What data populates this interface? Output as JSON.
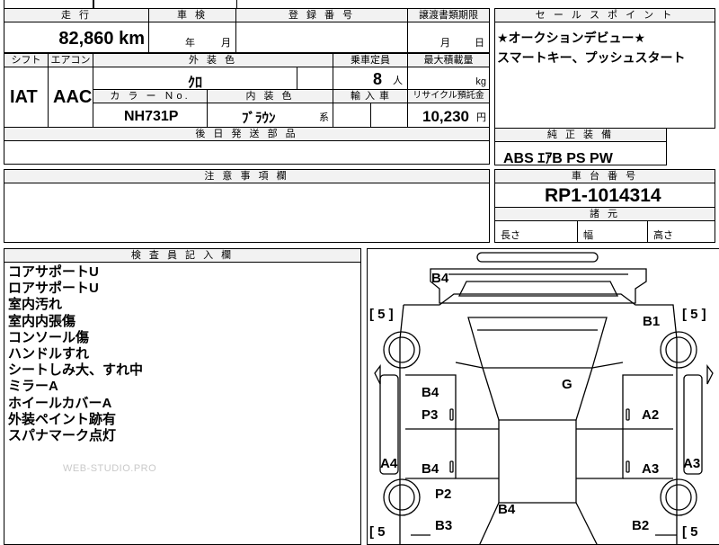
{
  "top_row": {
    "mileage_header": "走 行",
    "mileage_value": "82,860 km",
    "inspection_header": "車 検",
    "inspection_year": "年",
    "inspection_month": "月",
    "registration_header": "登 録 番 号",
    "transfer_header": "譲渡書類期限",
    "transfer_month": "月",
    "transfer_day": "日"
  },
  "sales_points": {
    "header": "セ ー ル ス ポ イ ン ト",
    "lines": [
      "★オークションデビュー★",
      "スマートキー、プッシュスタート"
    ]
  },
  "spec_row": {
    "shift_header": "シフト",
    "ac_header": "エアコン",
    "shift_value": "IAT",
    "ac_value": "AAC",
    "exterior_header": "外 装 色",
    "exterior_value": "ｸﾛ",
    "capacity_header": "乗車定員",
    "capacity_value": "8",
    "capacity_unit": "人",
    "max_load_header": "最大積載量",
    "max_load_unit": "kg",
    "color_no_header": "カ ラ ー Ｎo.",
    "interior_header": "内 装 色",
    "import_header": "輸 入 車",
    "recycle_header": "リサイクル預託金",
    "color_no_value": "NH731P",
    "interior_value": "ﾌﾞﾗｳﾝ",
    "interior_suffix": "系",
    "recycle_value": "10,230",
    "recycle_unit": "円"
  },
  "later_parts": {
    "header": "後 日 発 送 部 品"
  },
  "standard_equipment": {
    "header": "純 正 装 備",
    "value": "ABS ｴｱB PS PW"
  },
  "notes": {
    "header": "注 意 事 項 欄"
  },
  "chassis": {
    "header": "車 台 番 号",
    "value": "RP1-1014314",
    "dims_header": "諸 元",
    "length_label": "長さ",
    "width_label": "幅",
    "height_label": "高さ"
  },
  "inspector": {
    "header": "検 査 員 記 入 欄",
    "remarks": [
      "コアサポートU",
      "ロアサポートU",
      "室内汚れ",
      "室内内張傷",
      "コンソール傷",
      "ハンドルすれ",
      "シートしみ大、すれ中",
      "ミラーA",
      "ホイールカバーA",
      "外装ペイント跡有",
      "スパナマーク点灯"
    ],
    "watermark": "WEB-STUDIO.PRO"
  },
  "diagram": {
    "marks": {
      "front_b4": "B4",
      "b1": "B1",
      "g": "G",
      "left_front_b4": "B4",
      "p3": "P3",
      "a2": "A2",
      "a4": "A4",
      "left_rear_b4": "B4",
      "a3_right": "A3",
      "a3_edge": "A3",
      "p2": "P2",
      "rear_b4": "B4",
      "b3": "B3",
      "b2": "B2"
    },
    "tire_tl": "[ 5 ]",
    "tire_tr": "[ 5 ]",
    "tire_bl": "[ 5",
    "tire_br": "[ 5"
  }
}
